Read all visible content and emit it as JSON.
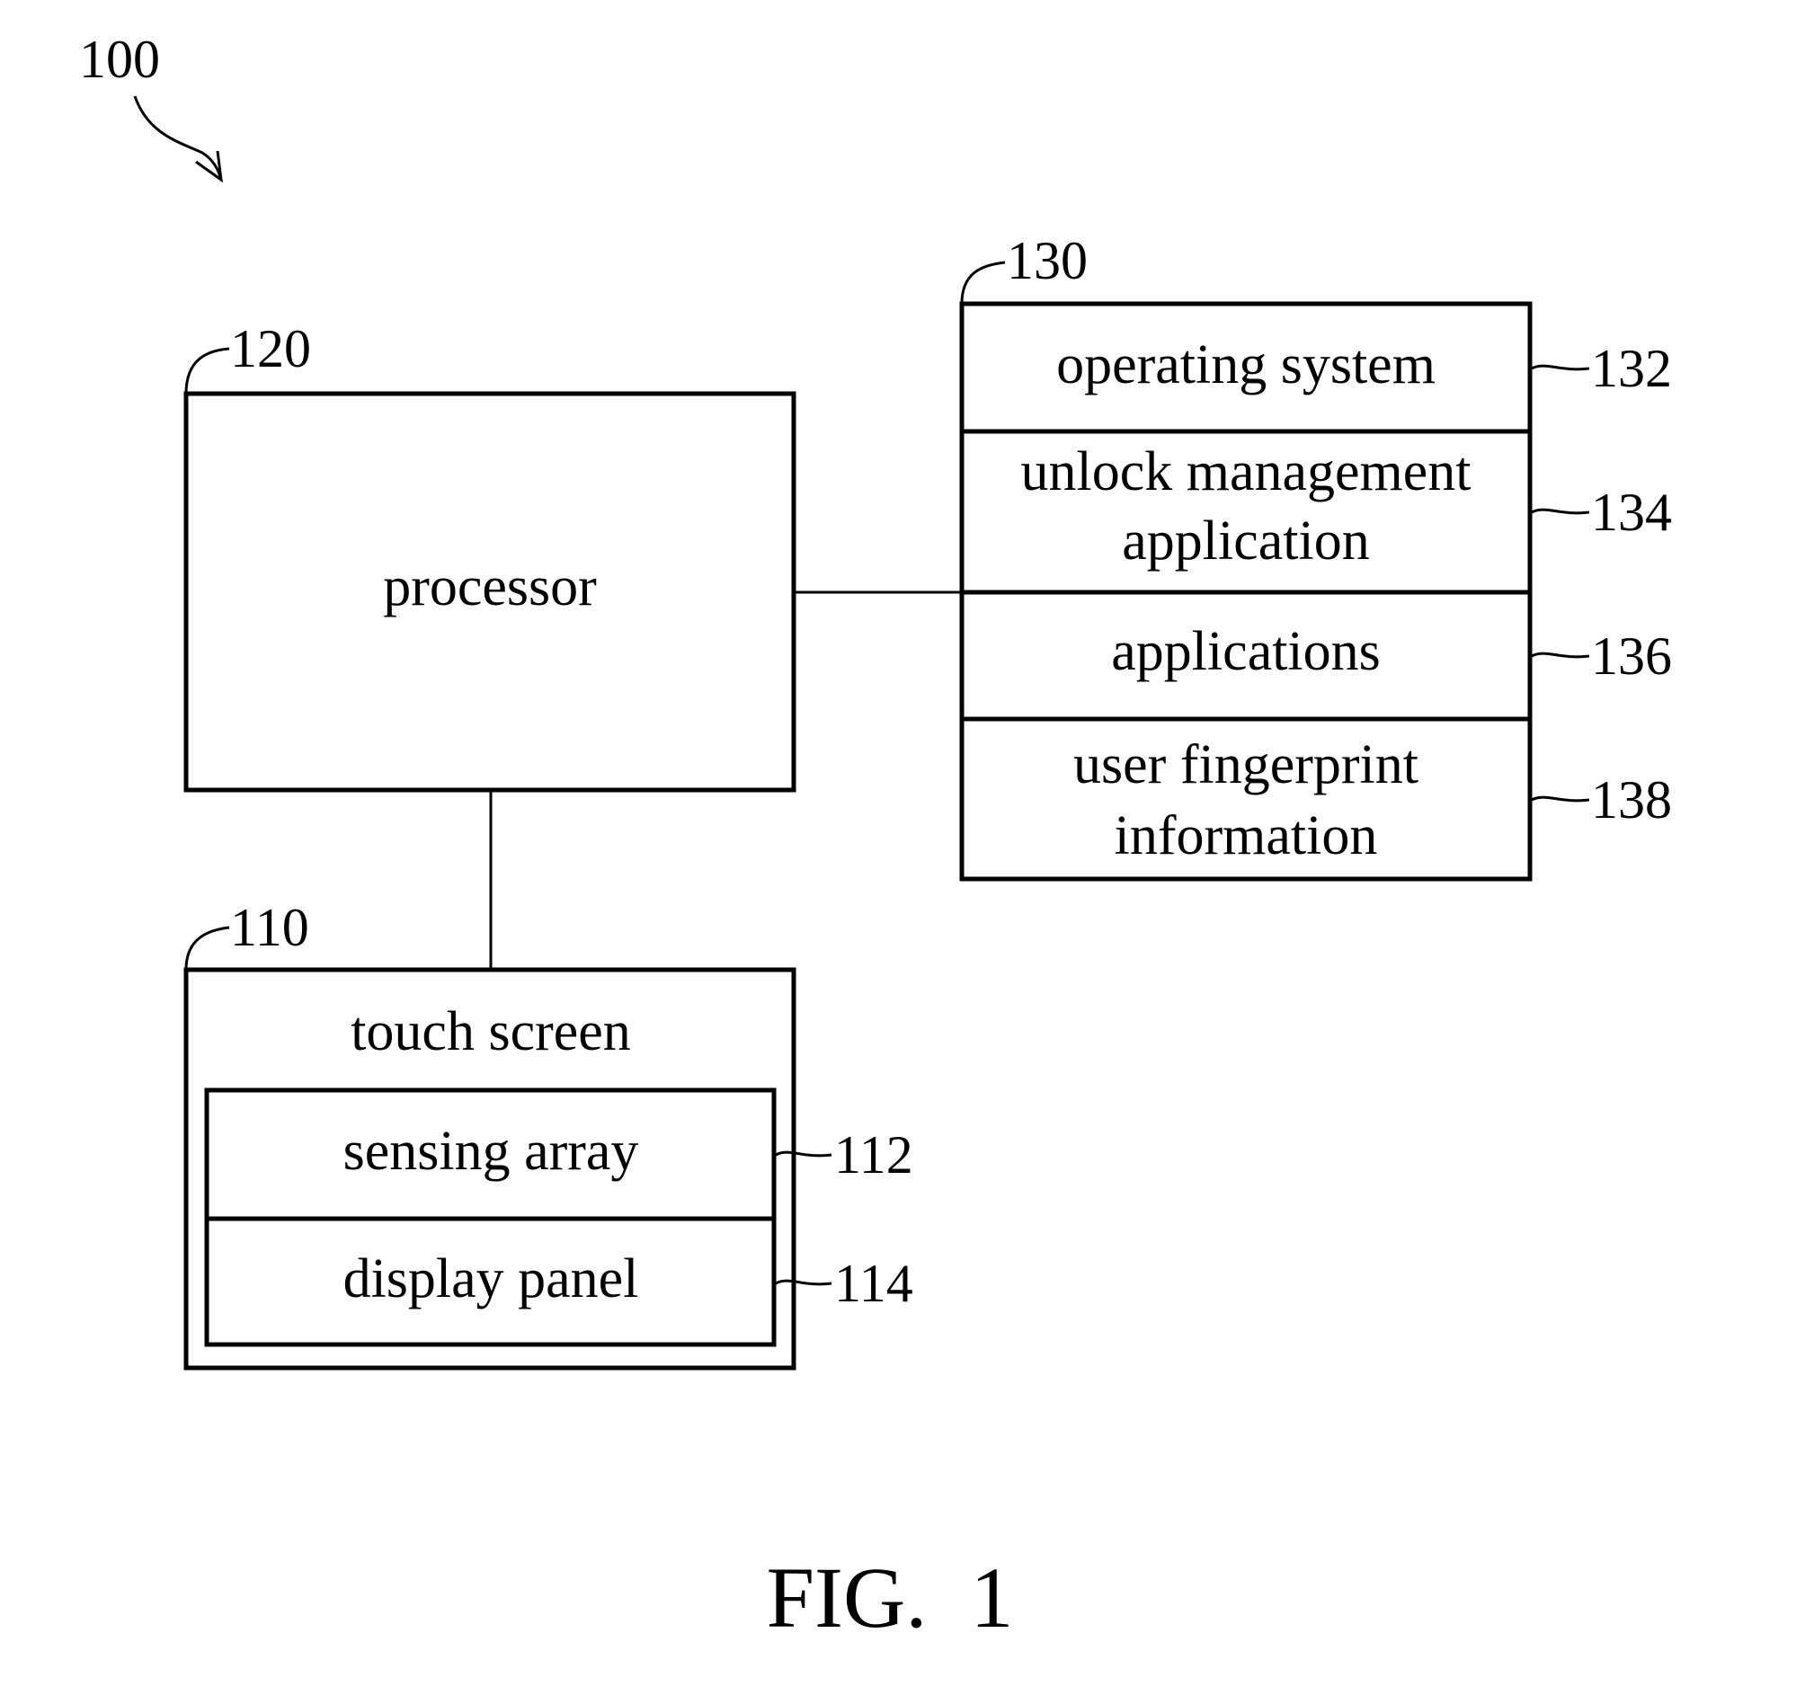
{
  "figure": {
    "ref_main": "100",
    "caption": "FIG.  1"
  },
  "processor": {
    "ref": "120",
    "label": "processor"
  },
  "memory": {
    "ref": "130",
    "sections": [
      {
        "ref": "132",
        "lines": [
          "operating system"
        ]
      },
      {
        "ref": "134",
        "lines": [
          "unlock management",
          "application"
        ]
      },
      {
        "ref": "136",
        "lines": [
          "applications"
        ]
      },
      {
        "ref": "138",
        "lines": [
          "user fingerprint",
          "information"
        ]
      }
    ]
  },
  "touch_screen": {
    "ref": "110",
    "label": "touch screen",
    "sections": [
      {
        "ref": "112",
        "label": "sensing array"
      },
      {
        "ref": "114",
        "label": "display panel"
      }
    ]
  }
}
